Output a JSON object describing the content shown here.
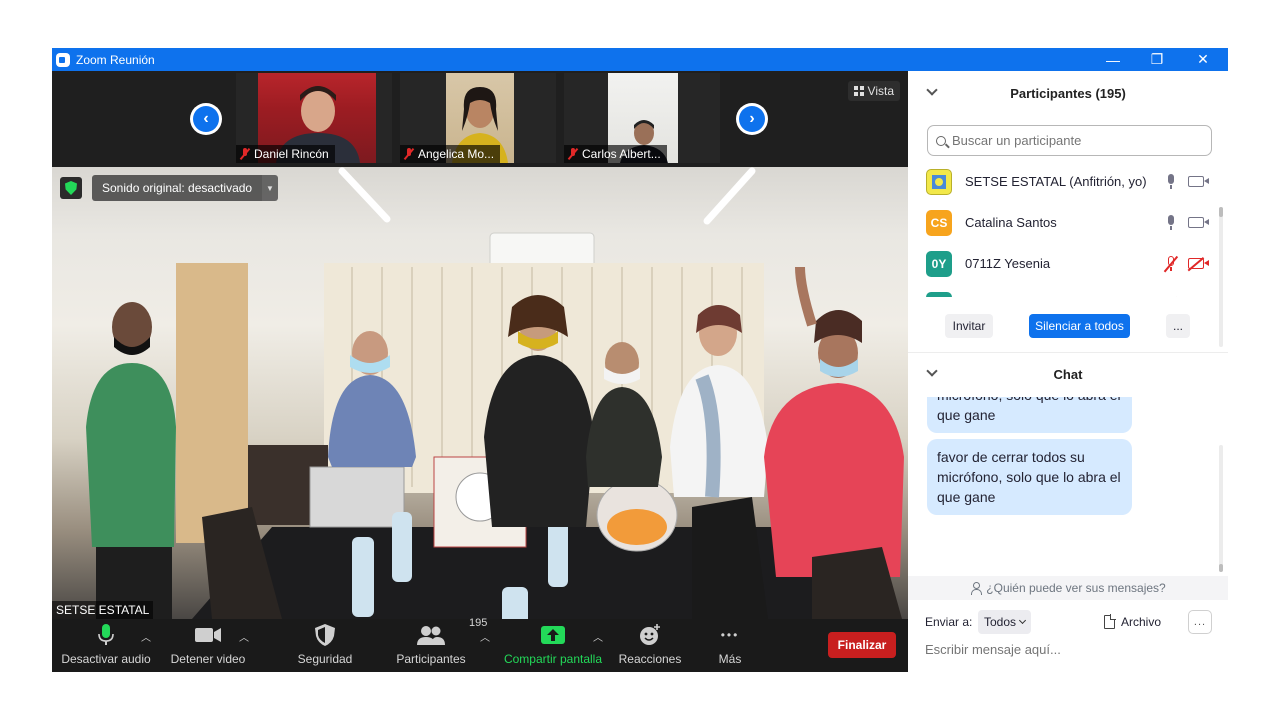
{
  "window": {
    "title": "Zoom Reunión",
    "controls": {
      "minimize": "—",
      "restore": "❐",
      "close": "✕"
    }
  },
  "gallery": {
    "prev_icon": "chevron-left-icon",
    "next_icon": "chevron-right-icon",
    "view_label": "Vista",
    "thumbnails": [
      {
        "name": "Daniel Rincón",
        "muted": true
      },
      {
        "name": "Angelica Mo...",
        "muted": true
      },
      {
        "name": "Carlos Albert...",
        "muted": true
      }
    ]
  },
  "main_video": {
    "sound_label": "Sonido original: desactivado",
    "speaker_name": "SETSE ESTATAL"
  },
  "toolbar": {
    "audio_label": "Desactivar audio",
    "video_label": "Detener video",
    "security_label": "Seguridad",
    "participants_label": "Participantes",
    "participants_count": "195",
    "share_label": "Compartir pantalla",
    "reactions_label": "Reacciones",
    "more_label": "Más",
    "more_dots": "•••",
    "end_label": "Finalizar"
  },
  "participants_panel": {
    "title": "Participantes (195)",
    "search_placeholder": "Buscar un participante",
    "rows": [
      {
        "initials": "",
        "name": "SETSE ESTATAL (Anfitrión, yo)",
        "avatar_color": "#f2e84a",
        "mic_muted": false,
        "cam_off": false
      },
      {
        "initials": "CS",
        "name": "Catalina Santos",
        "avatar_color": "#f7a41d",
        "mic_muted": false,
        "cam_off": false
      },
      {
        "initials": "0Y",
        "name": "0711Z Yesenia",
        "avatar_color": "#1e9e8a",
        "mic_muted": true,
        "cam_off": true
      },
      {
        "initials": "",
        "name": "",
        "avatar_color": "#1e9e8a",
        "mic_muted": true,
        "cam_off": true
      }
    ],
    "invite_label": "Invitar",
    "mute_all_label": "Silenciar a todos",
    "more_label": "..."
  },
  "chat_panel": {
    "title": "Chat",
    "messages": [
      "micrófono, solo que lo abra el que gane",
      "favor de cerrar todos su micrófono, solo que lo abra el que gane"
    ],
    "who_can_see": "¿Quién puede ver sus mensajes?",
    "send_to_label": "Enviar a:",
    "recipient": "Todos",
    "file_label": "Archivo",
    "more_dots": "...",
    "input_placeholder": "Escribir mensaje aquí..."
  },
  "colors": {
    "brand_blue": "#0e72ed",
    "end_red": "#c81f1f",
    "share_green": "#23d959",
    "muted_red": "#e02828",
    "bubble_blue": "#d6eaff"
  }
}
